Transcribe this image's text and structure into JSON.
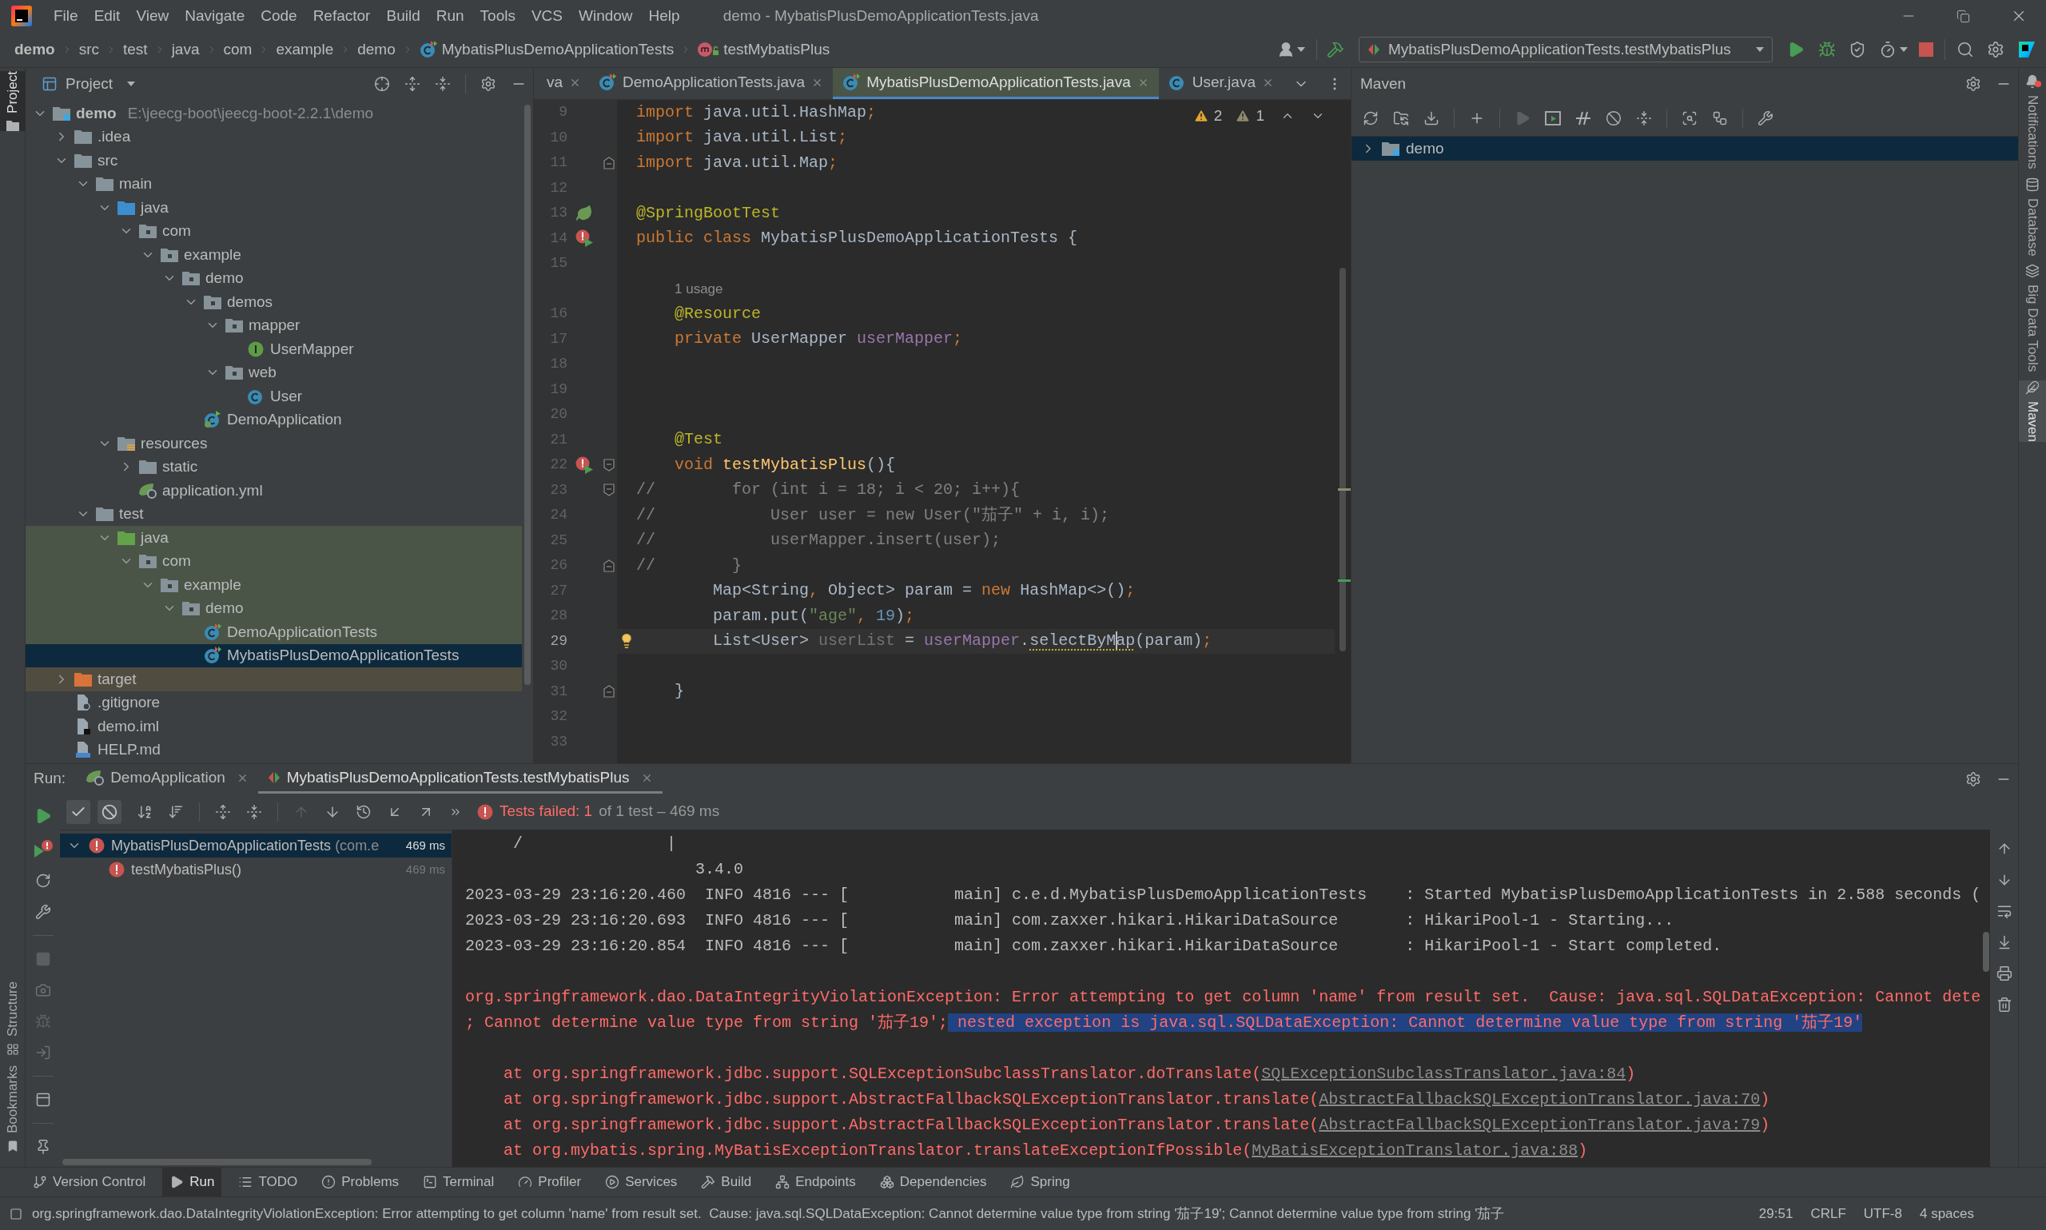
{
  "menu_bar": {
    "items": [
      "File",
      "Edit",
      "View",
      "Navigate",
      "Code",
      "Refactor",
      "Build",
      "Run",
      "Tools",
      "VCS",
      "Window",
      "Help"
    ],
    "title": "demo - MybatisPlusDemoApplicationTests.java"
  },
  "navigation_bar": {
    "breadcrumbs": [
      {
        "label": "demo",
        "kind": "project"
      },
      {
        "label": "src",
        "kind": "folder"
      },
      {
        "label": "test",
        "kind": "folder"
      },
      {
        "label": "java",
        "kind": "folder"
      },
      {
        "label": "com",
        "kind": "folder"
      },
      {
        "label": "example",
        "kind": "folder"
      },
      {
        "label": "demo",
        "kind": "folder"
      },
      {
        "label": "MybatisPlusDemoApplicationTests",
        "kind": "class"
      },
      {
        "label": "testMybatisPlus",
        "kind": "method"
      }
    ],
    "run_configuration": "MybatisPlusDemoApplicationTests.testMybatisPlus"
  },
  "left_stripe": {
    "top": [
      {
        "label": "Project",
        "kind": "project",
        "selected": true
      }
    ],
    "bottom": [
      {
        "label": "Structure",
        "kind": "structure",
        "selected": false
      },
      {
        "label": "Bookmarks",
        "kind": "bookmarks",
        "selected": false
      }
    ]
  },
  "project": {
    "title": "Project",
    "tree": [
      {
        "label": "demo",
        "path": "E:\\jeecg-boot\\jeecg-boot-2.2.1\\demo",
        "kind": "module",
        "expanded": true,
        "selected": false,
        "children": [
          {
            "label": ".idea",
            "kind": "folder",
            "expanded": false,
            "selected": false
          },
          {
            "label": "src",
            "kind": "folder",
            "expanded": true,
            "selected": false,
            "children": [
              {
                "label": "main",
                "kind": "folder",
                "expanded": true,
                "selected": false,
                "children": [
                  {
                    "label": "java",
                    "kind": "source-root",
                    "expanded": true,
                    "selected": false,
                    "children": [
                      {
                        "label": "com",
                        "kind": "package",
                        "expanded": true,
                        "selected": false,
                        "children": [
                          {
                            "label": "example",
                            "kind": "package",
                            "expanded": true,
                            "selected": false,
                            "children": [
                              {
                                "label": "demo",
                                "kind": "package",
                                "expanded": true,
                                "selected": false,
                                "children": [
                                  {
                                    "label": "demos",
                                    "kind": "package",
                                    "expanded": true,
                                    "selected": false,
                                    "children": [
                                      {
                                        "label": "mapper",
                                        "kind": "package",
                                        "expanded": true,
                                        "selected": false,
                                        "children": [
                                          {
                                            "label": "UserMapper",
                                            "kind": "interface",
                                            "selected": false
                                          }
                                        ]
                                      },
                                      {
                                        "label": "web",
                                        "kind": "package",
                                        "expanded": true,
                                        "selected": false,
                                        "children": [
                                          {
                                            "label": "User",
                                            "kind": "class",
                                            "selected": false
                                          }
                                        ]
                                      }
                                    ]
                                  },
                                  {
                                    "label": "DemoApplication",
                                    "kind": "spring-class",
                                    "selected": false
                                  }
                                ]
                              }
                            ]
                          }
                        ]
                      }
                    ]
                  },
                  {
                    "label": "resources",
                    "kind": "resources-root",
                    "expanded": true,
                    "selected": false,
                    "children": [
                      {
                        "label": "static",
                        "kind": "folder",
                        "expanded": false,
                        "selected": false
                      },
                      {
                        "label": "application.yml",
                        "kind": "spring-config",
                        "selected": false
                      }
                    ]
                  }
                ]
              },
              {
                "label": "test",
                "kind": "folder",
                "expanded": true,
                "selected": false,
                "children": [
                  {
                    "label": "java",
                    "kind": "test-root",
                    "expanded": true,
                    "selected": false,
                    "test_source": true,
                    "children": [
                      {
                        "label": "com",
                        "kind": "package",
                        "expanded": true,
                        "selected": false,
                        "test_source": true,
                        "children": [
                          {
                            "label": "example",
                            "kind": "package",
                            "expanded": true,
                            "selected": false,
                            "test_source": true,
                            "children": [
                              {
                                "label": "demo",
                                "kind": "package",
                                "expanded": true,
                                "selected": false,
                                "test_source": true,
                                "children": [
                                  {
                                    "label": "DemoApplicationTests",
                                    "kind": "test-class",
                                    "selected": false,
                                    "test_source": true
                                  },
                                  {
                                    "label": "MybatisPlusDemoApplicationTests",
                                    "kind": "test-class",
                                    "selected": true
                                  }
                                ]
                              }
                            ]
                          }
                        ]
                      }
                    ]
                  }
                ]
              }
            ]
          },
          {
            "label": "target",
            "kind": "excluded-folder",
            "expanded": false,
            "selected": false,
            "excluded": true
          },
          {
            "label": ".gitignore",
            "kind": "ignore-file",
            "selected": false
          },
          {
            "label": "demo.iml",
            "kind": "module-file",
            "selected": false
          },
          {
            "label": "HELP.md",
            "kind": "markdown-file",
            "selected": false
          }
        ]
      }
    ]
  },
  "editor": {
    "tabs": [
      {
        "label": "va",
        "kind": "partial",
        "selected": false
      },
      {
        "label": "DemoApplicationTests.java",
        "kind": "test-class",
        "selected": false
      },
      {
        "label": "MybatisPlusDemoApplicationTests.java",
        "kind": "test-class",
        "selected": true
      },
      {
        "label": "User.java",
        "kind": "class",
        "selected": false
      }
    ],
    "inspections": {
      "warnings": "2",
      "weak_warnings": "1"
    },
    "lines": [
      {
        "kind": "code",
        "number": "9",
        "current": false,
        "tokens": [
          {
            "text": "import",
            "kind": "keyword"
          },
          {
            "text": " java.util.HashMap",
            "kind": "plain"
          },
          {
            "text": ";",
            "kind": "punctuation"
          }
        ]
      },
      {
        "kind": "code",
        "number": "10",
        "current": false,
        "tokens": [
          {
            "text": "import",
            "kind": "keyword"
          },
          {
            "text": " java.util.List",
            "kind": "plain"
          },
          {
            "text": ";",
            "kind": "punctuation"
          }
        ]
      },
      {
        "kind": "code",
        "number": "11",
        "current": false,
        "fold": {
          "kind": "end"
        },
        "tokens": [
          {
            "text": "import",
            "kind": "keyword"
          },
          {
            "text": " java.util.Map",
            "kind": "plain"
          },
          {
            "text": ";",
            "kind": "punctuation"
          }
        ]
      },
      {
        "kind": "code",
        "number": "12",
        "current": false
      },
      {
        "kind": "code",
        "number": "13",
        "current": false,
        "gutter": {
          "kind": "spring"
        },
        "tokens": [
          {
            "text": "@SpringBootTest",
            "kind": "annotation"
          }
        ]
      },
      {
        "kind": "code",
        "number": "14",
        "current": false,
        "gutter": {
          "kind": "run-failed"
        },
        "tokens": [
          {
            "text": "public class",
            "kind": "keyword"
          },
          {
            "text": " MybatisPlusDemoApplicationTests {",
            "kind": "plain"
          }
        ]
      },
      {
        "kind": "code",
        "number": "15",
        "current": false
      },
      {
        "kind": "inlay",
        "text": "1 usage"
      },
      {
        "kind": "code",
        "number": "16",
        "current": false,
        "tokens": [
          {
            "text": "    @Resource",
            "kind": "annotation"
          }
        ]
      },
      {
        "kind": "code",
        "number": "17",
        "current": false,
        "tokens": [
          {
            "text": "    private",
            "kind": "keyword"
          },
          {
            "text": " UserMapper ",
            "kind": "plain"
          },
          {
            "text": "userMapper",
            "kind": "field"
          },
          {
            "text": ";",
            "kind": "punctuation"
          }
        ]
      },
      {
        "kind": "code",
        "number": "18",
        "current": false
      },
      {
        "kind": "code",
        "number": "19",
        "current": false
      },
      {
        "kind": "code",
        "number": "20",
        "current": false
      },
      {
        "kind": "code",
        "number": "21",
        "current": false,
        "tokens": [
          {
            "text": "    @Test",
            "kind": "annotation"
          }
        ]
      },
      {
        "kind": "code",
        "number": "22",
        "current": false,
        "gutter": {
          "kind": "run-failed"
        },
        "fold": {
          "kind": "start"
        },
        "tokens": [
          {
            "text": "    void ",
            "kind": "keyword"
          },
          {
            "text": "testMybatisPlus",
            "kind": "method"
          },
          {
            "text": "(){",
            "kind": "plain"
          }
        ]
      },
      {
        "kind": "code",
        "number": "23",
        "current": false,
        "fold": {
          "kind": "start"
        },
        "tokens": [
          {
            "text": "//        for (int i = 18; i < 20; i++){",
            "kind": "comment"
          }
        ]
      },
      {
        "kind": "code",
        "number": "24",
        "current": false,
        "tokens": [
          {
            "text": "//            User user = new User(\"茄子\" + i, i);",
            "kind": "comment"
          }
        ]
      },
      {
        "kind": "code",
        "number": "25",
        "current": false,
        "tokens": [
          {
            "text": "//            userMapper.insert(user);",
            "kind": "comment"
          }
        ]
      },
      {
        "kind": "code",
        "number": "26",
        "current": false,
        "fold": {
          "kind": "end"
        },
        "tokens": [
          {
            "text": "//        }",
            "kind": "comment"
          }
        ]
      },
      {
        "kind": "code",
        "number": "27",
        "current": false,
        "tokens": [
          {
            "text": "        Map<String",
            "kind": "plain"
          },
          {
            "text": ",",
            "kind": "punctuation"
          },
          {
            "text": " Object> param = ",
            "kind": "plain"
          },
          {
            "text": "new",
            "kind": "keyword"
          },
          {
            "text": " HashMap<>()",
            "kind": "plain"
          },
          {
            "text": ";",
            "kind": "punctuation"
          }
        ]
      },
      {
        "kind": "code",
        "number": "28",
        "current": false,
        "tokens": [
          {
            "text": "        param.put(",
            "kind": "plain"
          },
          {
            "text": "\"age\"",
            "kind": "string"
          },
          {
            "text": ", ",
            "kind": "punctuation"
          },
          {
            "text": "19",
            "kind": "number"
          },
          {
            "text": ")",
            "kind": "plain"
          },
          {
            "text": ";",
            "kind": "punctuation"
          }
        ]
      },
      {
        "kind": "code",
        "number": "29",
        "current": true,
        "marker": {
          "kind": "bulb"
        },
        "tokens": [
          {
            "text": "        List<User> ",
            "kind": "plain"
          },
          {
            "text": "userList",
            "kind": "unused"
          },
          {
            "text": " = ",
            "kind": "plain"
          },
          {
            "text": "userMapper",
            "kind": "field"
          },
          {
            "text": ".",
            "kind": "plain"
          },
          {
            "text": "selectByM",
            "kind": "warning"
          },
          {
            "text": "ap",
            "kind": "warning",
            "caret": true
          },
          {
            "text": "(param)",
            "kind": "plain"
          },
          {
            "text": ";",
            "kind": "punctuation"
          }
        ]
      },
      {
        "kind": "code",
        "number": "30",
        "current": false
      },
      {
        "kind": "code",
        "number": "31",
        "current": false,
        "fold": {
          "kind": "end"
        },
        "tokens": [
          {
            "text": "    }",
            "kind": "plain"
          }
        ]
      },
      {
        "kind": "code",
        "number": "32",
        "current": false
      },
      {
        "kind": "code",
        "number": "33",
        "current": false
      }
    ]
  },
  "maven": {
    "title": "Maven",
    "tree": [
      {
        "label": "demo",
        "expanded": false,
        "selected": true
      }
    ]
  },
  "right_stripe": [
    {
      "label": "Notifications",
      "kind": "notifications",
      "selected": false,
      "unread": true
    },
    {
      "label": "Database",
      "kind": "database",
      "selected": false
    },
    {
      "label": "Big Data Tools",
      "kind": "big-data",
      "selected": false
    },
    {
      "label": "Maven",
      "kind": "maven",
      "selected": true
    }
  ],
  "run": {
    "label": "Run:",
    "tabs": [
      {
        "label": "DemoApplication",
        "kind": "spring",
        "selected": false
      },
      {
        "label": "MybatisPlusDemoApplicationTests.testMybatisPlus",
        "kind": "test",
        "selected": true
      }
    ],
    "toggles": [
      {
        "kind": "passed",
        "on": true
      },
      {
        "kind": "ignored",
        "on": true
      }
    ],
    "status": {
      "failed": "Tests failed: 1",
      "summary": "of 1 test – 469 ms"
    },
    "tests": [
      {
        "label": "MybatisPlusDemoApplicationTests",
        "location": "(com.e",
        "time": "469 ms",
        "failed": true,
        "expanded": true,
        "selected": true,
        "children": [
          {
            "label": "testMybatisPlus()",
            "time": "469 ms",
            "failed": true,
            "selected": false
          }
        ]
      }
    ],
    "console": {
      "lines": [
        {
          "kind": "plain",
          "text": "     /               |"
        },
        {
          "kind": "plain",
          "text": "                        3.4.0"
        },
        {
          "kind": "plain",
          "text": "2023-03-29 23:16:20.460  INFO 4816 --- [           main] c.e.d.MybatisPlusDemoApplicationTests    : Started MybatisPlusDemoApplicationTests in 2.588 seconds ("
        },
        {
          "kind": "plain",
          "text": "2023-03-29 23:16:20.693  INFO 4816 --- [           main] com.zaxxer.hikari.HikariDataSource       : HikariPool-1 - Starting..."
        },
        {
          "kind": "plain",
          "text": "2023-03-29 23:16:20.854  INFO 4816 --- [           main] com.zaxxer.hikari.HikariDataSource       : HikariPool-1 - Start completed."
        },
        {
          "kind": "blank"
        },
        {
          "kind": "error",
          "parts": [
            {
              "text": "org.springframework.dao.DataIntegrityViolationException: Error attempting to get column 'name' from result set.  Cause: java.sql.SQLDataException: Cannot dete",
              "selected": false
            }
          ]
        },
        {
          "kind": "error",
          "parts": [
            {
              "text": "; Cannot determine value type from string '茄子19';",
              "selected": false
            },
            {
              "text": " nested exception is java.sql.SQLDataException: Cannot determine value type from string '茄子19'",
              "selected": true
            }
          ]
        },
        {
          "kind": "blank"
        },
        {
          "kind": "trace",
          "text": "    at org.springframework.jdbc.support.SQLExceptionSubclassTranslator.doTranslate(",
          "link": "SQLExceptionSubclassTranslator.java:84",
          "end": ")"
        },
        {
          "kind": "trace",
          "text": "    at org.springframework.jdbc.support.AbstractFallbackSQLExceptionTranslator.translate(",
          "link": "AbstractFallbackSQLExceptionTranslator.java:70",
          "end": ")"
        },
        {
          "kind": "trace",
          "text": "    at org.springframework.jdbc.support.AbstractFallbackSQLExceptionTranslator.translate(",
          "link": "AbstractFallbackSQLExceptionTranslator.java:79",
          "end": ")"
        },
        {
          "kind": "trace",
          "text": "    at org.mybatis.spring.MyBatisExceptionTranslator.translateExceptionIfPossible(",
          "link": "MyBatisExceptionTranslator.java:88",
          "end": ")"
        }
      ]
    }
  },
  "tool_tabs": [
    {
      "label": "Version Control",
      "kind": "vcs",
      "selected": false
    },
    {
      "label": "Run",
      "kind": "run",
      "selected": true
    },
    {
      "label": "TODO",
      "kind": "todo",
      "selected": false
    },
    {
      "label": "Problems",
      "kind": "problems",
      "selected": false
    },
    {
      "label": "Terminal",
      "kind": "terminal",
      "selected": false
    },
    {
      "label": "Profiler",
      "kind": "profiler",
      "selected": false
    },
    {
      "label": "Services",
      "kind": "services",
      "selected": false
    },
    {
      "label": "Build",
      "kind": "build",
      "selected": false
    },
    {
      "label": "Endpoints",
      "kind": "endpoints",
      "selected": false
    },
    {
      "label": "Dependencies",
      "kind": "dependencies",
      "selected": false
    },
    {
      "label": "Spring",
      "kind": "spring",
      "selected": false
    }
  ],
  "status_bar": {
    "message": "org.springframework.dao.DataIntegrityViolationException: Error attempting to get column 'name' from result set.  Cause: java.sql.SQLDataException: Cannot determine value type from string '茄子19'; Cannot determine value type from string '茄子",
    "caret_position": "29:51",
    "line_separator": "CRLF",
    "encoding": "UTF-8",
    "indent": "4 spaces"
  }
}
